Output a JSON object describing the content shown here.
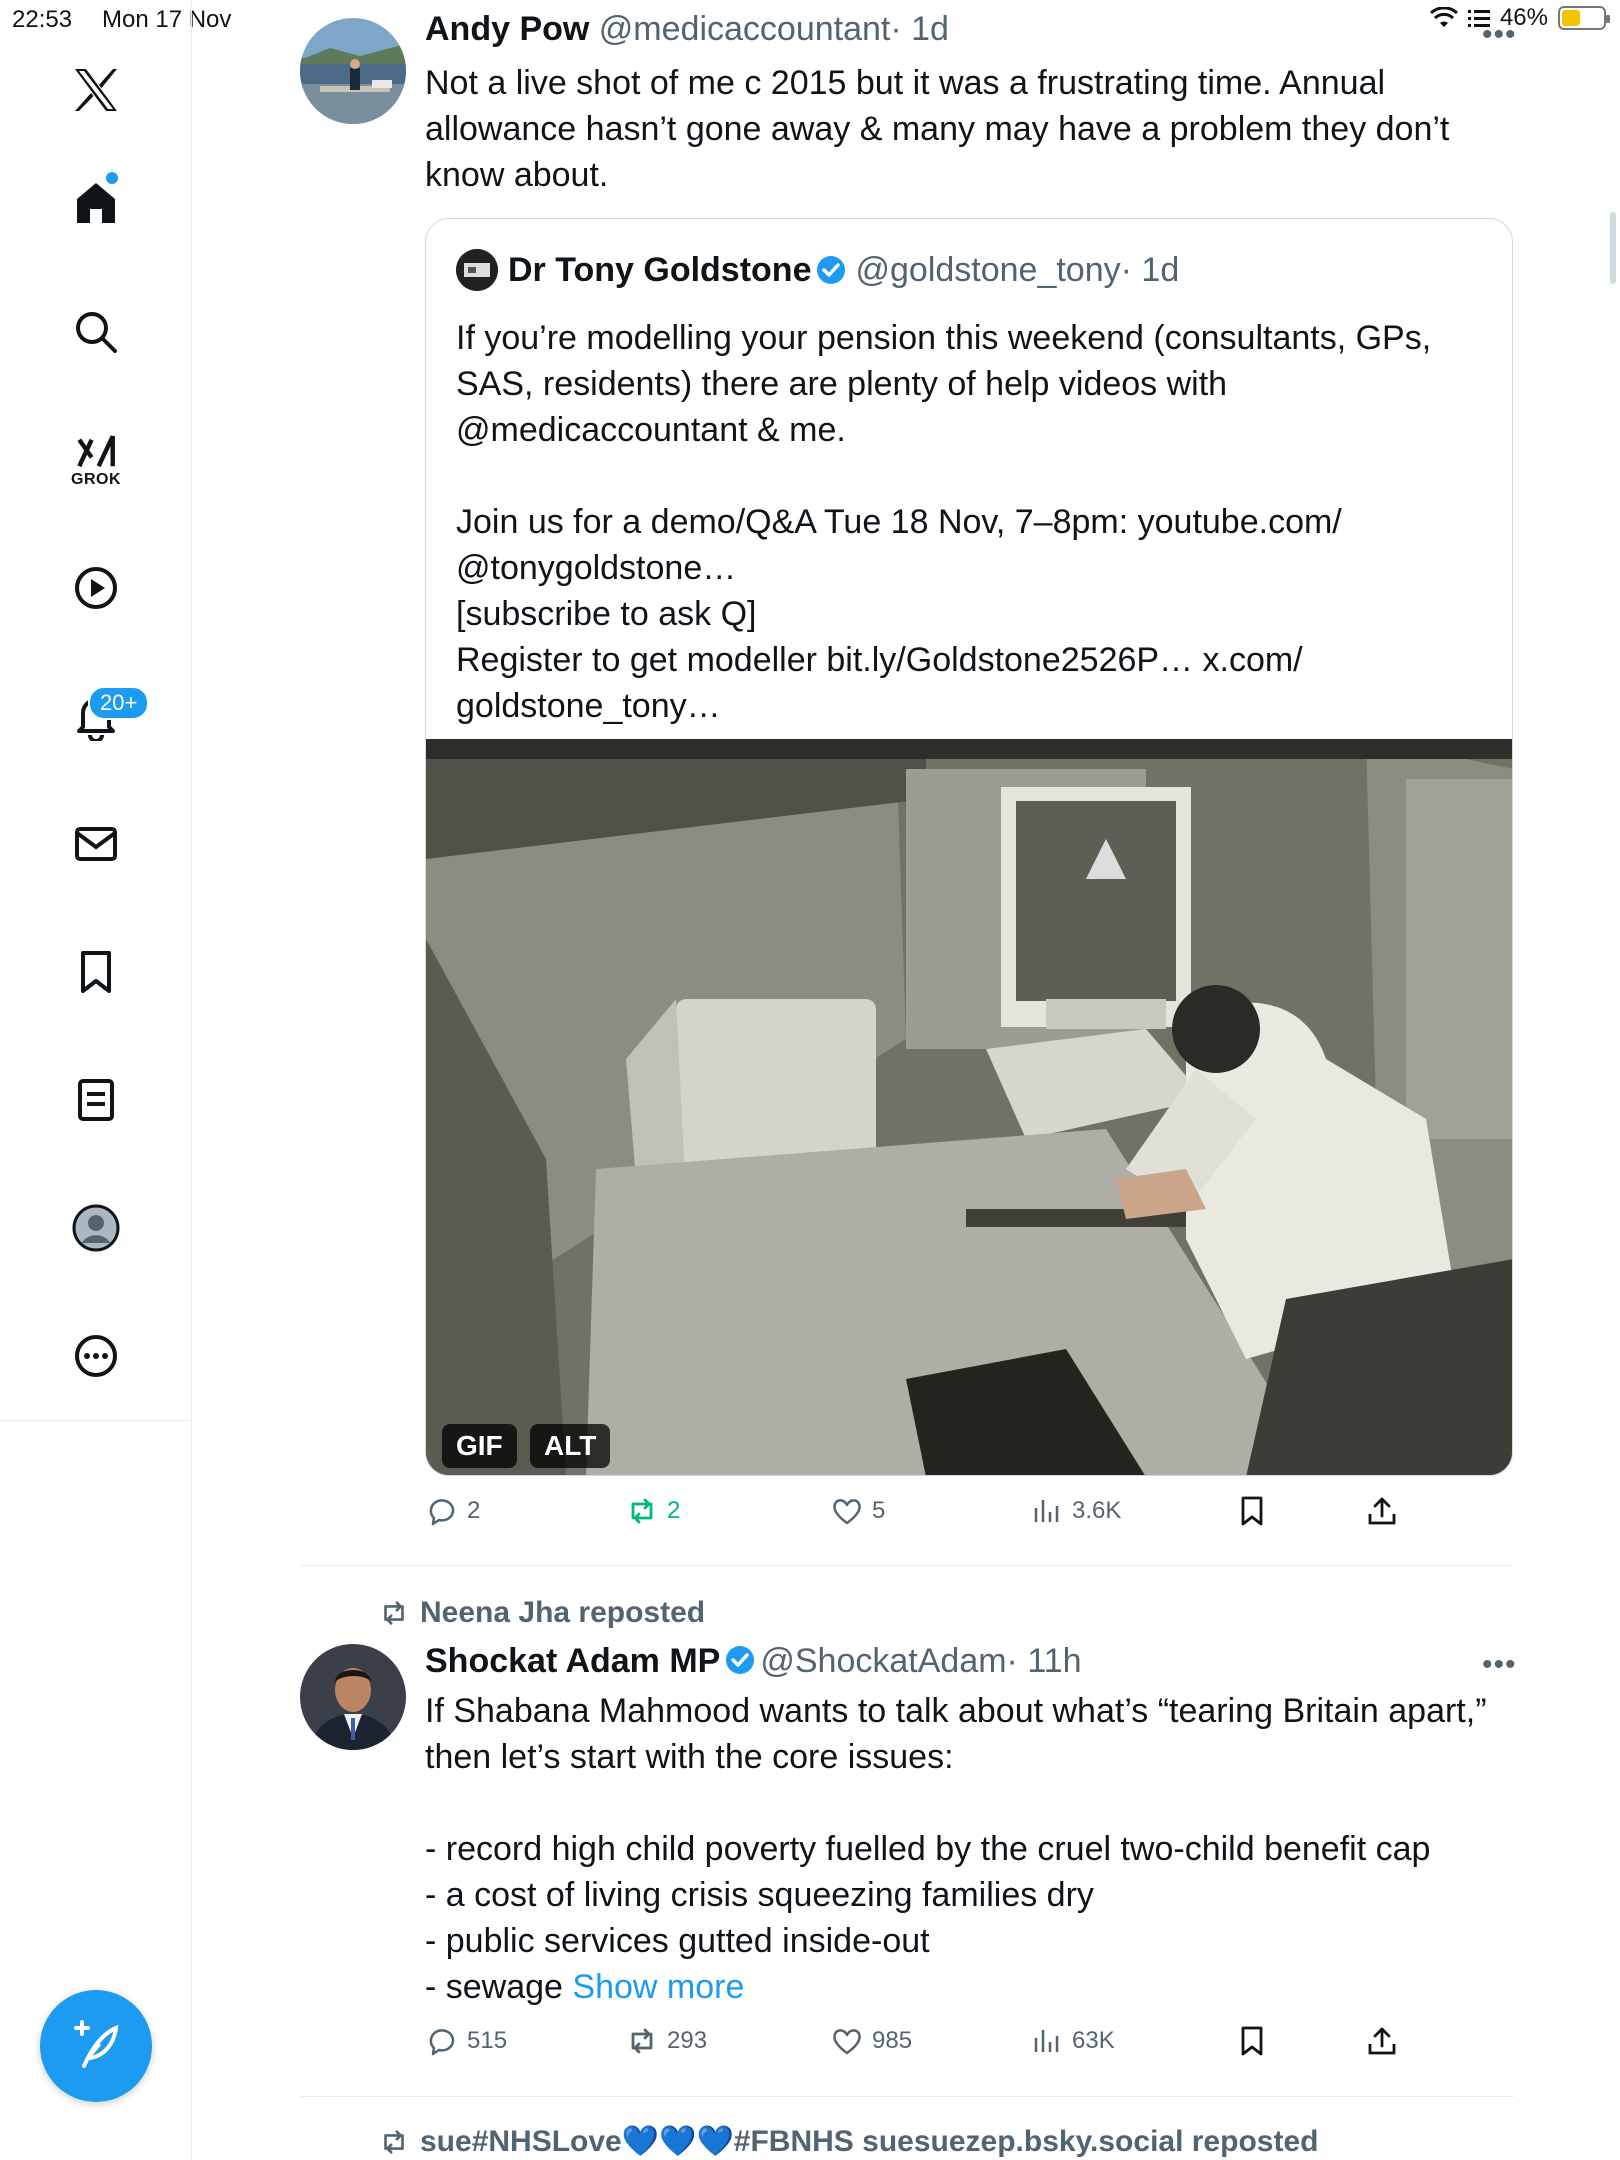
{
  "status_bar": {
    "time": "22:53",
    "date": "Mon 17 Nov",
    "battery": "46%",
    "battery_level": 0.46,
    "battery_color": "#f5c400"
  },
  "sidebar": {
    "items": [
      {
        "name": "x-logo",
        "icon": "x-logo-icon"
      },
      {
        "name": "home",
        "icon": "home-icon",
        "active": true
      },
      {
        "name": "search",
        "icon": "search-icon"
      },
      {
        "name": "grok",
        "icon": "grok-icon",
        "label": "GROK"
      },
      {
        "name": "videos",
        "icon": "play-icon"
      },
      {
        "name": "notifications",
        "icon": "bell-icon",
        "badge": "20+"
      },
      {
        "name": "messages",
        "icon": "mail-icon"
      },
      {
        "name": "bookmarks",
        "icon": "bookmark-icon"
      },
      {
        "name": "lists",
        "icon": "list-icon"
      },
      {
        "name": "profile",
        "icon": "avatar-icon"
      },
      {
        "name": "more",
        "icon": "more-icon"
      }
    ],
    "accent": "#1d9bf0"
  },
  "tweets": [
    {
      "name": "Andy Pow",
      "handle": "@medicaccountant",
      "time": "· 1d",
      "text": "Not a live shot of me c 2015 but it was a frustrating time. Annual\nallowance hasn’t gone away & many may have a problem they don’t\nknow about.",
      "quote": {
        "name": "Dr Tony Goldstone",
        "handle": "@goldstone_tony",
        "time": "· 1d",
        "text": "If you’re modelling your pension this weekend (consultants, GPs,\nSAS, residents) there are plenty of help videos with\n@medicaccountant & me.\n\nJoin us for a demo/Q&A Tue 18 Nov, 7–8pm: youtube.com/\n@tonygoldstone…\n[subscribe to ask Q]\nRegister to get modeller bit.ly/Goldstone2526P… x.com/\ngoldstone_tony…",
        "media_tags": {
          "gif": "GIF",
          "alt": "ALT"
        }
      },
      "stats": {
        "replies": "2",
        "reposts": "2",
        "likes": "5",
        "views": "3.6K"
      }
    },
    {
      "repost_by": "Neena Jha reposted",
      "name": "Shockat Adam MP",
      "handle": "@ShockatAdam",
      "time": "· 11h",
      "text": "If Shabana Mahmood wants to talk about what’s “tearing Britain apart,”\nthen let’s start with the core issues:\n\n- record high child poverty fuelled by the cruel two-child benefit cap\n- a cost of living crisis squeezing families dry\n- public services gutted inside-out\n- sewage ",
      "show_more": "Show more",
      "stats": {
        "replies": "515",
        "reposts": "293",
        "likes": "985",
        "views": "63K"
      }
    },
    {
      "repost_by": "sue#NHSLove💙💙💙#FBNHS suesuezep.bsky.social reposted"
    }
  ]
}
